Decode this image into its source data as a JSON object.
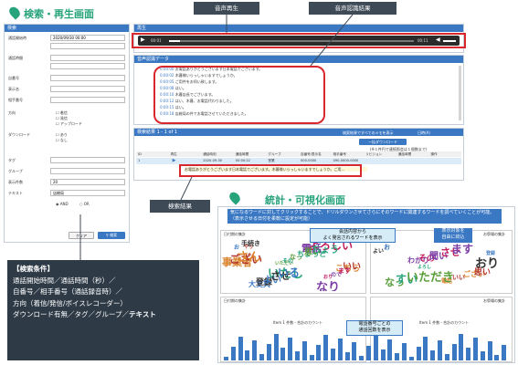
{
  "search_screen": {
    "title": "検索・再生画面",
    "search_panel": {
      "header": "検索",
      "fields": [
        {
          "label": "通話開始時",
          "value": "2020/09/30 00:00"
        },
        {
          "label": "通話時間",
          "value": ""
        },
        {
          "label": "自番号",
          "value": ""
        },
        {
          "label": "表示名",
          "value": ""
        },
        {
          "label": "相手番号",
          "value": ""
        },
        {
          "label": "方向",
          "value": ""
        },
        {
          "label": "ダウンロード",
          "value": ""
        },
        {
          "label": "タグ",
          "value": ""
        },
        {
          "label": "グループ",
          "value": ""
        },
        {
          "label": "表示件数",
          "value": "20"
        },
        {
          "label": "テキスト",
          "value": "店総局"
        }
      ],
      "direction_options": [
        "着信",
        "発信",
        "アップロード"
      ],
      "download_options": [
        "あり",
        "なし"
      ],
      "andor": [
        "AND",
        "OR"
      ],
      "clear_button": "クリア",
      "search_button": "検索"
    },
    "player": {
      "header": "再生",
      "time_start": "00:01",
      "time_end": "00:11"
    },
    "transcript": {
      "header": "音声認識データ",
      "lines": [
        {
          "ts": "0:00:00",
          "text": "お電話ありがとうございます日本電話でございます。"
        },
        {
          "ts": "0:00:02",
          "text": "木暮様いらっしゃいますでしょうか。"
        },
        {
          "ts": "0:00:05",
          "text": "ご用件をお伺い致します。"
        },
        {
          "ts": "0:00:08",
          "text": "はい。"
        },
        {
          "ts": "0:00:10",
          "text": "木暮店長でございます。"
        },
        {
          "ts": "0:00:12",
          "text": "はい、木暮、お電話代わりました。"
        },
        {
          "ts": "0:00:15",
          "text": "はい。"
        },
        {
          "ts": "0:00:18",
          "text": "店総局の件でお電話させていただきました。"
        }
      ]
    },
    "results": {
      "header": "検索結果 1 - 1 of 1",
      "options": [
        "検索結果ですべてのメモを表示",
        "日時(A)"
      ],
      "download_button": "一括ダウンロード",
      "note": "(※１件円で連続照会は１個数まで)",
      "columns": [
        "ID",
        "再生",
        "通話時刻",
        "通話時間",
        "グループ",
        "自番号/表示名",
        "相手番号",
        "リビジョン",
        "通話時間",
        "操作"
      ],
      "row": [
        "1",
        "",
        "2020-09-30",
        "00:00:22",
        "営業",
        "000-0000",
        "090-0000-0000",
        "",
        "",
        ""
      ],
      "excerpt": "お電話ありがとうございます日本電話でございます。木暮様いらっしゃいますでしょうか。ご用..."
    }
  },
  "callouts": {
    "audio": "音声再生",
    "asr": "音声認識結果",
    "search_result": "検索結果"
  },
  "search_conditions": {
    "title": "【検索条件】",
    "lines": [
      "通話開始時間／通話時間（秒）／",
      "自番号／相手番号（通話録音時）／",
      "方向（着信/発信/ボイスレコーダー）",
      "ダウンロード有無／タグ／グループ／"
    ],
    "last_bold": "テキスト"
  },
  "viz_screen": {
    "title": "統計・可視化画面",
    "description": "気になるワードに対してクリックすることで、ドリルダウンさせてさらにそのワードに関連するワードを調べていくことが可能。（表示させる日付を柔軟に設定が可能）",
    "panels": {
      "left": "日付期の集計",
      "right": "お祭場の集計",
      "bottom_left": "日付期の集計",
      "bottom_right": "お祭場の集計"
    },
    "callout_top": "会話内容から\nよく発言されるワードを表示",
    "callout_right": "表示対象を\n自由に絞込",
    "callout_bottom": "電話番号ごとの\n通話回数を表示",
    "chart_labels": [
      "Item 1 件数 - 合計のカウント",
      "Item 1 件数 - 合計のカウント"
    ],
    "words_left": [
      "お",
      "いたし",
      "電話",
      "こちら",
      "手続き",
      "いただい",
      "よろしい",
      "いい",
      "大丈夫",
      "その",
      "なり",
      "事業者",
      "登録",
      "なっ",
      "おり",
      "ござい",
      "よい",
      "ちょっと",
      "ので",
      "さん",
      "させ",
      "思い",
      "ます",
      "やっ",
      "いる",
      "ちょう"
    ],
    "words_right": [
      "わかり",
      "電話",
      "おり",
      "なっ",
      "その",
      "いい",
      "登録",
      "すい",
      "聞い",
      "ござい",
      "よい",
      "いただき",
      "させ",
      "思い",
      "お",
      "よろし",
      "ます"
    ]
  }
}
